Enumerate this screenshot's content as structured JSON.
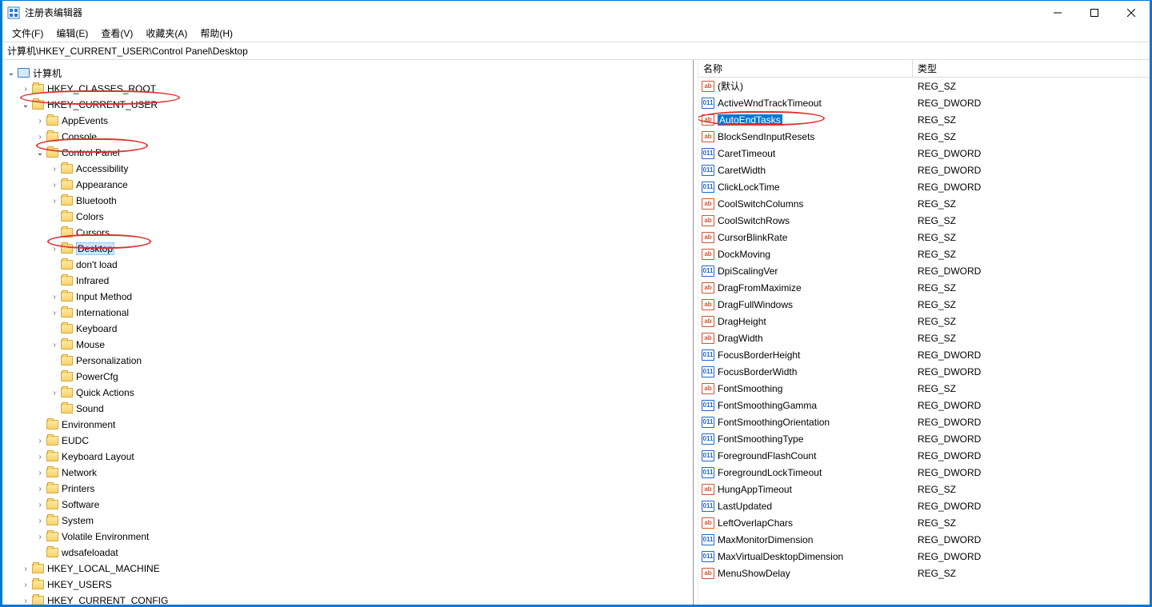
{
  "window": {
    "title": "注册表编辑器"
  },
  "menu": {
    "file": "文件(F)",
    "edit": "编辑(E)",
    "view": "查看(V)",
    "favorites": "收藏夹(A)",
    "help": "帮助(H)"
  },
  "address": "计算机\\HKEY_CURRENT_USER\\Control Panel\\Desktop",
  "columns": {
    "name": "名称",
    "type": "类型"
  },
  "tree": {
    "root": "计算机",
    "hkcr": "HKEY_CLASSES_ROOT",
    "hkcu": "HKEY_CURRENT_USER",
    "hkcu_items": [
      "AppEvents",
      "Console",
      "Control Panel"
    ],
    "cp_items": [
      "Accessibility",
      "Appearance",
      "Bluetooth",
      "Colors",
      "Cursors",
      "Desktop",
      "don't load",
      "Infrared",
      "Input Method",
      "International",
      "Keyboard",
      "Mouse",
      "Personalization",
      "PowerCfg",
      "Quick Actions",
      "Sound"
    ],
    "after_cp": [
      "Environment",
      "EUDC",
      "Keyboard Layout",
      "Network",
      "Printers",
      "Software",
      "System",
      "Volatile Environment",
      "wdsafeloadat"
    ],
    "hklm": "HKEY_LOCAL_MACHINE",
    "hku": "HKEY_USERS",
    "hkcc": "HKEY_CURRENT_CONFIG"
  },
  "values": [
    {
      "name": "(默认)",
      "type": "REG_SZ",
      "icon": "sz"
    },
    {
      "name": "ActiveWndTrackTimeout",
      "type": "REG_DWORD",
      "icon": "dw"
    },
    {
      "name": "AutoEndTasks",
      "type": "REG_SZ",
      "icon": "sz",
      "selected": true
    },
    {
      "name": "BlockSendInputResets",
      "type": "REG_SZ",
      "icon": "sz"
    },
    {
      "name": "CaretTimeout",
      "type": "REG_DWORD",
      "icon": "dw"
    },
    {
      "name": "CaretWidth",
      "type": "REG_DWORD",
      "icon": "dw"
    },
    {
      "name": "ClickLockTime",
      "type": "REG_DWORD",
      "icon": "dw"
    },
    {
      "name": "CoolSwitchColumns",
      "type": "REG_SZ",
      "icon": "sz"
    },
    {
      "name": "CoolSwitchRows",
      "type": "REG_SZ",
      "icon": "sz"
    },
    {
      "name": "CursorBlinkRate",
      "type": "REG_SZ",
      "icon": "sz"
    },
    {
      "name": "DockMoving",
      "type": "REG_SZ",
      "icon": "sz"
    },
    {
      "name": "DpiScalingVer",
      "type": "REG_DWORD",
      "icon": "dw"
    },
    {
      "name": "DragFromMaximize",
      "type": "REG_SZ",
      "icon": "sz"
    },
    {
      "name": "DragFullWindows",
      "type": "REG_SZ",
      "icon": "sz"
    },
    {
      "name": "DragHeight",
      "type": "REG_SZ",
      "icon": "sz"
    },
    {
      "name": "DragWidth",
      "type": "REG_SZ",
      "icon": "sz"
    },
    {
      "name": "FocusBorderHeight",
      "type": "REG_DWORD",
      "icon": "dw"
    },
    {
      "name": "FocusBorderWidth",
      "type": "REG_DWORD",
      "icon": "dw"
    },
    {
      "name": "FontSmoothing",
      "type": "REG_SZ",
      "icon": "sz"
    },
    {
      "name": "FontSmoothingGamma",
      "type": "REG_DWORD",
      "icon": "dw"
    },
    {
      "name": "FontSmoothingOrientation",
      "type": "REG_DWORD",
      "icon": "dw"
    },
    {
      "name": "FontSmoothingType",
      "type": "REG_DWORD",
      "icon": "dw"
    },
    {
      "name": "ForegroundFlashCount",
      "type": "REG_DWORD",
      "icon": "dw"
    },
    {
      "name": "ForegroundLockTimeout",
      "type": "REG_DWORD",
      "icon": "dw"
    },
    {
      "name": "HungAppTimeout",
      "type": "REG_SZ",
      "icon": "sz"
    },
    {
      "name": "LastUpdated",
      "type": "REG_DWORD",
      "icon": "dw"
    },
    {
      "name": "LeftOverlapChars",
      "type": "REG_SZ",
      "icon": "sz"
    },
    {
      "name": "MaxMonitorDimension",
      "type": "REG_DWORD",
      "icon": "dw"
    },
    {
      "name": "MaxVirtualDesktopDimension",
      "type": "REG_DWORD",
      "icon": "dw"
    },
    {
      "name": "MenuShowDelay",
      "type": "REG_SZ",
      "icon": "sz"
    }
  ]
}
